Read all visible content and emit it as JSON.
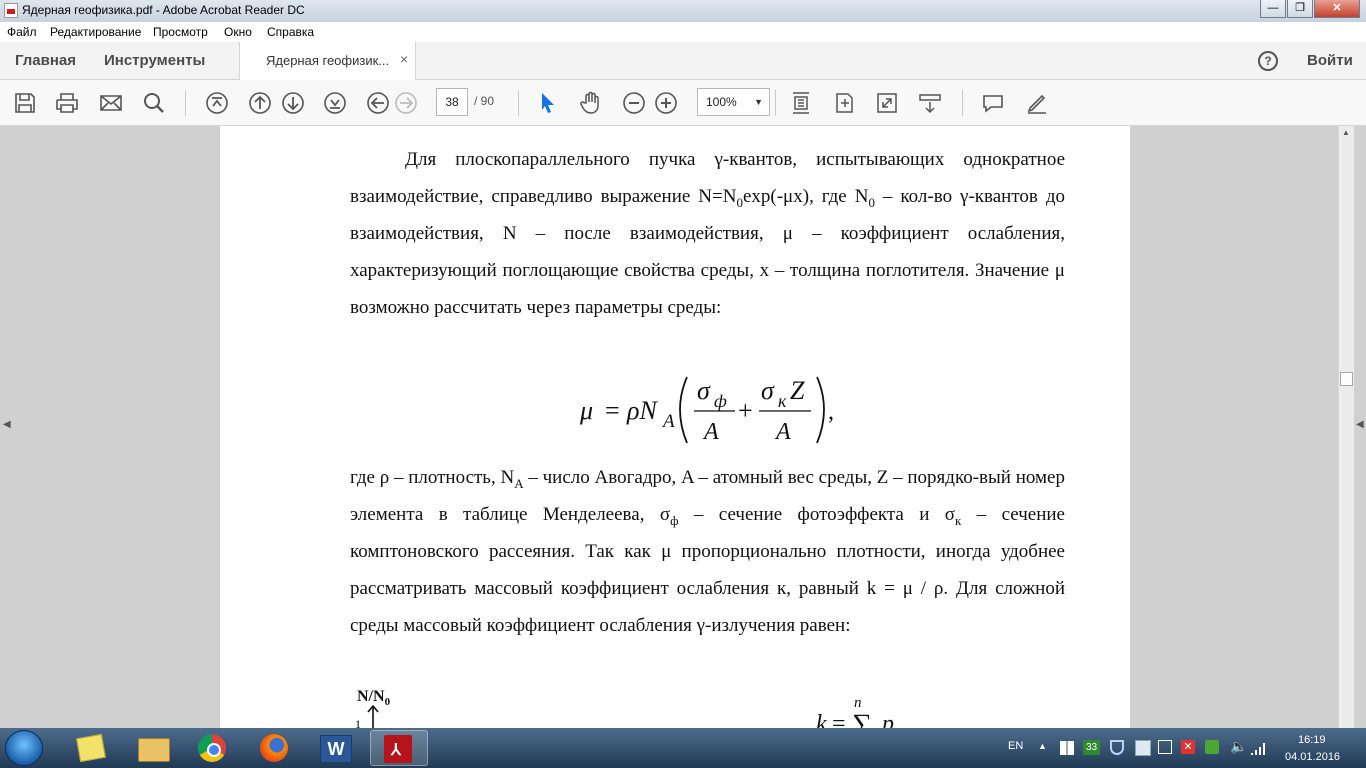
{
  "window": {
    "title": "Ядерная геофизика.pdf - Adobe Acrobat Reader DC",
    "minimize": "—",
    "maximize": "❐",
    "close": "✕"
  },
  "menu": [
    "Файл",
    "Редактирование",
    "Просмотр",
    "Окно",
    "Справка"
  ],
  "tabs": {
    "home": "Главная",
    "tools": "Инструменты",
    "doc": "Ядерная геофизик...",
    "doc_close": "×",
    "help": "?",
    "signin": "Войти"
  },
  "toolbar": {
    "page_current": "38",
    "page_total": "/ 90",
    "zoom": "100%",
    "icons": [
      "save-icon",
      "print-icon",
      "email-icon",
      "search-icon",
      "first-page-icon",
      "prev-page-icon",
      "next-page-icon",
      "last-page-icon",
      "back-icon",
      "forward-icon",
      "select-cursor-icon",
      "hand-tool-icon",
      "zoom-out-icon",
      "zoom-in-icon",
      "fit-page-icon",
      "rotate-icon",
      "fullscreen-icon",
      "scroll-mode-icon",
      "comment-icon",
      "highlight-icon"
    ]
  },
  "document": {
    "para1": [
      {
        "t": "Для плоскопараллельного пучка γ-квантов, испытывающих однократное взаимодействие, справедливо выражение N=N"
      },
      {
        "t": "0",
        "sub": true
      },
      {
        "t": "exp(-μx), где N"
      },
      {
        "t": "0",
        "sub": true
      },
      {
        "t": " – кол-во γ-квантов до взаимодействия, N – после взаимодействия, μ – коэффициент ослабления, характеризующий поглощающие свойства среды, x – толщина поглотителя. Значение μ возможно рассчитать через параметры среды:"
      }
    ],
    "formula": {
      "mu": "μ",
      "eq": "=",
      "rho_n": "ρN",
      "a_sub": "A",
      "sigma": "σ",
      "phi_sub": "ф",
      "plus": "+",
      "k_sub": "к",
      "z": "Z",
      "den1": "A",
      "den2": "A",
      "comma": ","
    },
    "para2": [
      {
        "t": "где ρ – плотность, N"
      },
      {
        "t": "A",
        "sub": true
      },
      {
        "t": " – число Авогадро, A – атомный вес среды, Z – порядко-вый номер элемента в таблице Менделеева, σ"
      },
      {
        "t": "ф",
        "sub": true
      },
      {
        "t": " – сечение фотоэффекта и σ"
      },
      {
        "t": "к",
        "sub": true
      },
      {
        "t": " – сечение комптоновского рассеяния. Так как μ пропорционально плотности, иногда удобнее рассматривать массовый коэффициент ослабления к, равный k = μ / ρ. Для сложной среды массовый коэффициент ослабления γ-излучения равен:"
      }
    ],
    "graph_label": "N/N",
    "graph_label_sub": "0",
    "graph_tick": "1",
    "sum_formula": {
      "k": "k",
      "eq": "=",
      "sigma": "∑",
      "n": "n",
      "terms": "p"
    }
  },
  "taskbar": {
    "apps": [
      "file-explorer-icon",
      "chrome-icon",
      "firefox-icon",
      "word-icon",
      "acrobat-icon"
    ],
    "lang": "EN",
    "tray_badge": "33",
    "time": "16:19",
    "date": "04.01.2016"
  }
}
